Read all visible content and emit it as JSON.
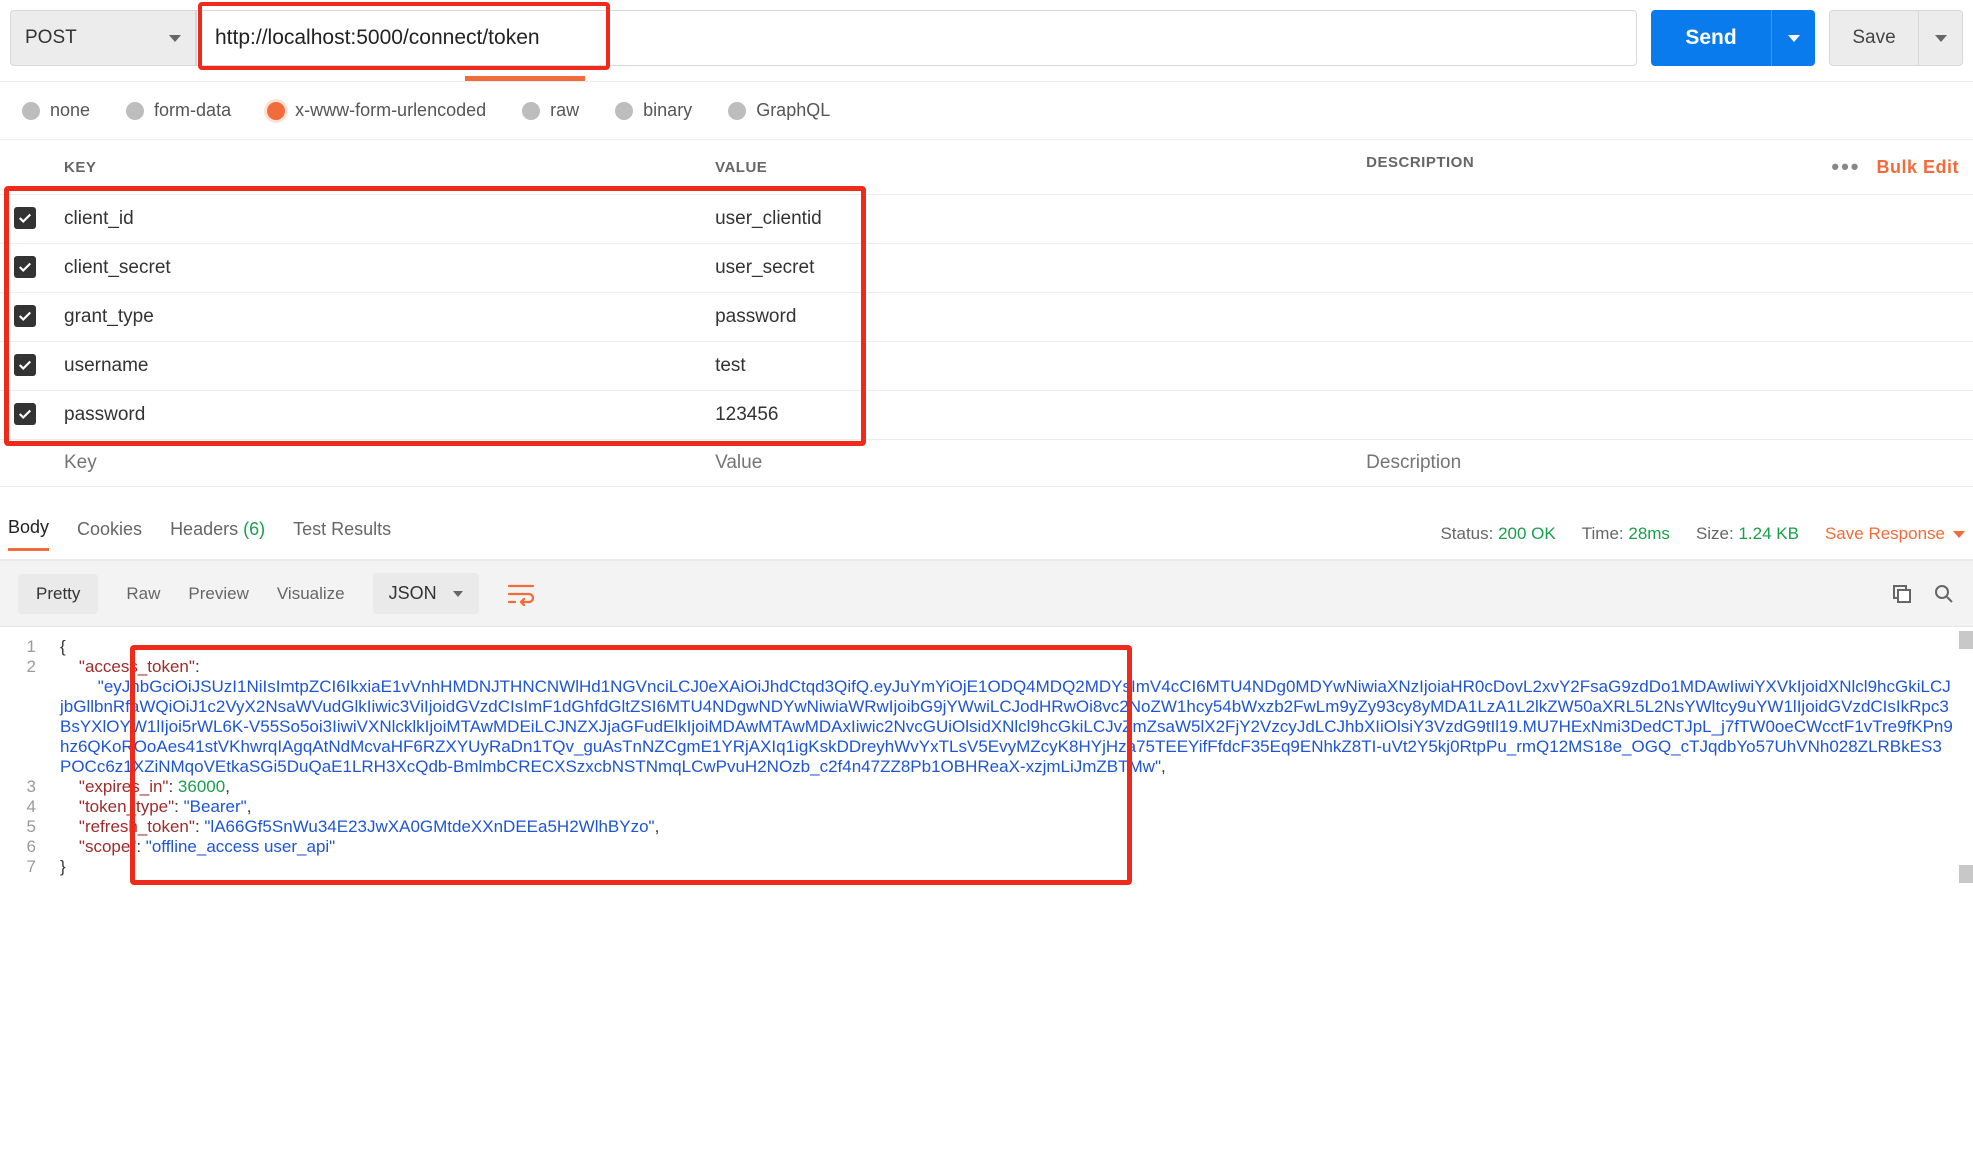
{
  "request": {
    "method": "POST",
    "url": "http://localhost:5000/connect/token",
    "sendLabel": "Send",
    "saveLabel": "Save"
  },
  "bodyTypes": {
    "none": "none",
    "formdata": "form-data",
    "urlencoded": "x-www-form-urlencoded",
    "raw": "raw",
    "binary": "binary",
    "graphql": "GraphQL"
  },
  "kvHeader": {
    "key": "KEY",
    "value": "VALUE",
    "desc": "DESCRIPTION",
    "bulk": "Bulk Edit"
  },
  "params": [
    {
      "key": "client_id",
      "value": "user_clientid"
    },
    {
      "key": "client_secret",
      "value": "user_secret"
    },
    {
      "key": "grant_type",
      "value": "password"
    },
    {
      "key": "username",
      "value": "test"
    },
    {
      "key": "password",
      "value": "123456"
    }
  ],
  "placeholders": {
    "key": "Key",
    "value": "Value",
    "desc": "Description"
  },
  "respTabs": {
    "body": "Body",
    "cookies": "Cookies",
    "headers": "Headers",
    "hcount": "(6)",
    "tests": "Test Results"
  },
  "respMeta": {
    "statusLabel": "Status:",
    "status": "200 OK",
    "timeLabel": "Time:",
    "time": "28ms",
    "sizeLabel": "Size:",
    "size": "1.24 KB",
    "saveResp": "Save Response"
  },
  "prettyBar": {
    "pretty": "Pretty",
    "raw": "Raw",
    "preview": "Preview",
    "visualize": "Visualize",
    "json": "JSON"
  },
  "json": {
    "access_token_key": "\"access_token\"",
    "access_token_val": "\"eyJhbGciOiJSUzI1NiIsImtpZCI6IkxiaE1vVnhHMDNJTHNCNWlHd1NGVnciLCJ0eXAiOiJhdCtqd3QifQ.eyJuYmYiOjE1ODQ4MDQ2MDYsImV4cCI6MTU4NDg0MDYwNiwiaXNzIjoiaHR0cDovL2xvY2FsaG9zdDo1MDAwIiwiYXVkIjoidXNlcl9hcGkiLCJjbGllbnRfaWQiOiJ1c2VyX2NsaWVudGlkIiwic3ViIjoidGVzdCIsImF1dGhfdGltZSI6MTU4NDgwNDYwNiwiaWRwIjoibG9jYWwiLCJodHRwOi8vc2NoZW1hcy54bWxzb2FwLm9yZy93cy8yMDA1LzA1L2lkZW50aXRL5L2NsYWltcy9uYW1lIjoidGVzdCIsIkRpc3BsYXlOYW1lIjoi5rWL6K-V55So5oi3IiwiVXNlcklkIjoiMTAwMDEiLCJNZXJjaGFudElkIjoiMDAwMTAwMDAxIiwic2NvcGUiOlsidXNlcl9hcGkiLCJvZmZsaW5lX2FjY2VzcyJdLCJhbXIiOlsiY3VzdG9tIl19.MU7HExNmi3DedCTJpL_j7fTW0oeCWcctF1vTre9fKPn9hz6QKoROoAes41stVKhwrqIAgqAtNdMcvaHF6RZXYUyRaDn1TQv_guAsTnNZCgmE1YRjAXIq1igKskDDreyhWvYxTLsV5EvyMZcyK8HYjHza75TEEYifFfdcF35Eq9ENhkZ8TI-uVt2Y5kj0RtpPu_rmQ12MS18e_OGQ_cTJqdbYo57UhVNh028ZLRBkES3POCc6z1XZiNMqoVEtkaSGi5DuQaE1LRH3XcQdb-BmlmbCRECXSzxcbNSTNmqLCwPvuH2NOzb_c2f4n47ZZ8Pb1OBHReaX-xzjmLiJmZBTMw\"",
    "expires_in_key": "\"expires_in\"",
    "expires_in_val": "36000",
    "token_type_key": "\"token_type\"",
    "token_type_val": "\"Bearer\"",
    "refresh_token_key": "\"refresh_token\"",
    "refresh_token_val": "\"lA66Gf5SnWu34E23JwXA0GMtdeXXnDEEa5H2WlhBYzo\"",
    "scope_key": "\"scope\"",
    "scope_val": "\"offline_access user_api\""
  }
}
